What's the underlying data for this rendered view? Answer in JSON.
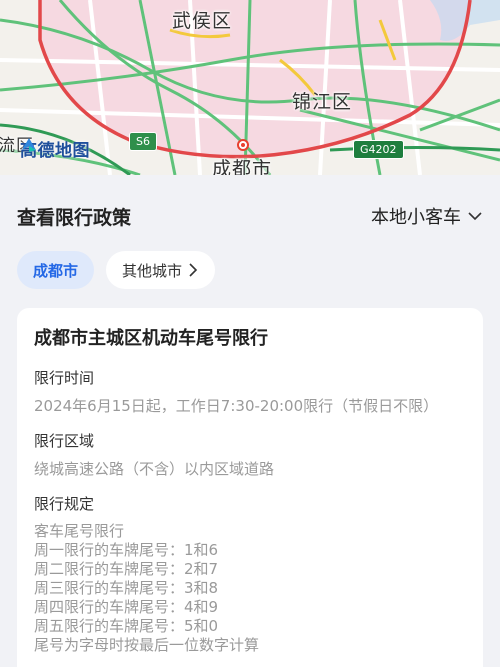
{
  "map": {
    "labels": {
      "wuhou": "武侯区",
      "jinjiang": "锦江区",
      "chengdu": "成都市",
      "partial_left": "流区"
    },
    "badges": {
      "s6": "S6",
      "g4202": "G4202"
    },
    "brand": "高德地图",
    "icons": {
      "brand_logo": "amap-logo-icon",
      "center": "city-center-pin-icon"
    }
  },
  "header": {
    "title": "查看限行政策",
    "vehicle_type": "本地小客车",
    "vehicle_icon": "chevron-down-icon"
  },
  "chips": {
    "current_city": "成都市",
    "other_cities": "其他城市",
    "other_icon": "chevron-right-icon"
  },
  "policy": {
    "title": "成都市主城区机动车尾号限行",
    "time_label": "限行时间",
    "time_text": "2024年6月15日起，工作日7:30-20:00限行（节假日不限）",
    "area_label": "限行区域",
    "area_text": "绕城高速公路（不含）以内区域道路",
    "rules_label": "限行规定",
    "rules": [
      "客车尾号限行",
      "周一限行的车牌尾号：1和6",
      "周二限行的车牌尾号：2和7",
      "周三限行的车牌尾号：3和8",
      "周四限行的车牌尾号：4和9",
      "周五限行的车牌尾号：5和0",
      "尾号为字母时按最后一位数字计算"
    ]
  },
  "colors": {
    "accent": "#2468e6",
    "chip_active_bg": "#dfe9fb",
    "ring_road": "#e2484a",
    "map_zone": "#f5d6de"
  }
}
